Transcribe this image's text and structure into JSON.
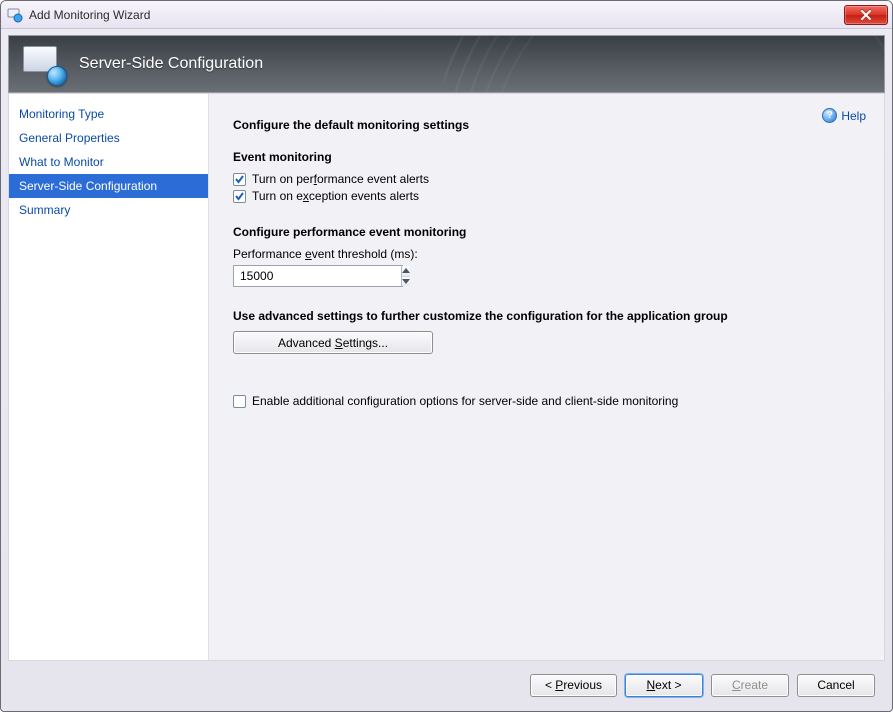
{
  "window": {
    "title": "Add Monitoring Wizard"
  },
  "banner": {
    "title": "Server-Side Configuration"
  },
  "sidebar": {
    "items": [
      {
        "label": "Monitoring Type"
      },
      {
        "label": "General Properties"
      },
      {
        "label": "What to Monitor"
      },
      {
        "label": "Server-Side Configuration"
      },
      {
        "label": "Summary"
      }
    ],
    "active_index": 3
  },
  "help": {
    "label": "Help"
  },
  "content": {
    "heading": "Configure the default monitoring settings",
    "event_monitoring": {
      "title": "Event monitoring",
      "perf_alerts": {
        "pre": "Turn on per",
        "u": "f",
        "post": "ormance event alerts",
        "checked": true
      },
      "exc_alerts": {
        "pre": "Turn on e",
        "u": "x",
        "post": "ception events alerts",
        "checked": true
      }
    },
    "perf_config": {
      "title": "Configure performance event monitoring",
      "threshold_label": {
        "pre": "Performance ",
        "u": "e",
        "post": "vent threshold (ms):"
      },
      "threshold_value": "15000"
    },
    "advanced": {
      "title": "Use advanced settings to further customize the configuration for the application group",
      "button": {
        "pre": "Advanced ",
        "u": "S",
        "post": "ettings..."
      }
    },
    "extra_config": {
      "label": "Enable additional configuration options for server-side and client-side monitoring",
      "checked": false
    }
  },
  "footer": {
    "previous": {
      "pre": "< ",
      "u": "P",
      "post": "revious"
    },
    "next": {
      "pre": "",
      "u": "N",
      "post": "ext >"
    },
    "create": {
      "pre": "",
      "u": "C",
      "post": "reate",
      "disabled": true
    },
    "cancel": "Cancel"
  }
}
